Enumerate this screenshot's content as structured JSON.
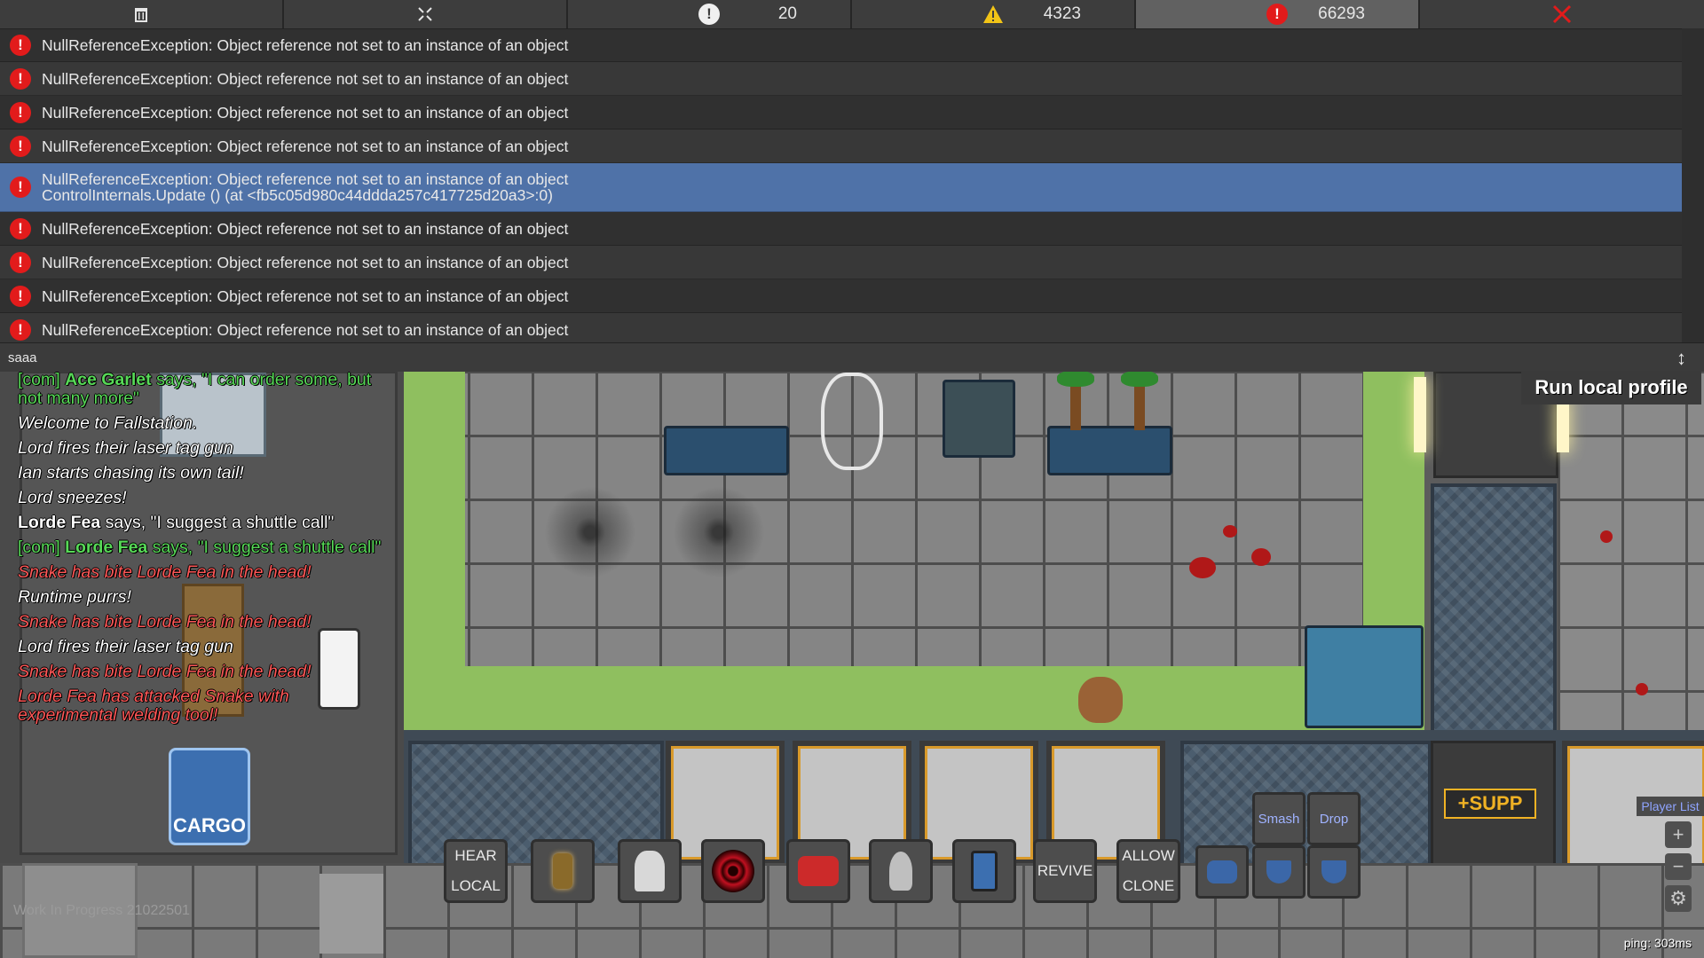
{
  "console": {
    "toolbar": {
      "clear_icon": "trash-icon",
      "collapse_icon": "collapse-arrows-icon",
      "log_icon": "info-icon",
      "log_count": "20",
      "warning_icon": "warning-icon",
      "warning_count": "4323",
      "error_icon": "error-icon",
      "error_count": "66293",
      "close_icon": "close-icon"
    },
    "entries": [
      {
        "text": "NullReferenceException: Object reference not set to an instance of an object",
        "detail": ""
      },
      {
        "text": "NullReferenceException: Object reference not set to an instance of an object",
        "detail": ""
      },
      {
        "text": "NullReferenceException: Object reference not set to an instance of an object",
        "detail": ""
      },
      {
        "text": "NullReferenceException: Object reference not set to an instance of an object",
        "detail": ""
      },
      {
        "text": "NullReferenceException: Object reference not set to an instance of an object",
        "detail": "ControlInternals.Update () (at <fb5c05d980c44ddda257c417725d20a3>:0)"
      },
      {
        "text": "NullReferenceException: Object reference not set to an instance of an object",
        "detail": ""
      },
      {
        "text": "NullReferenceException: Object reference not set to an instance of an object",
        "detail": ""
      },
      {
        "text": "NullReferenceException: Object reference not set to an instance of an object",
        "detail": ""
      },
      {
        "text": "NullReferenceException: Object reference not set to an instance of an object",
        "detail": ""
      }
    ],
    "input_value": "saaa"
  },
  "run_profile_label": "Run local profile",
  "chat": [
    {
      "type": "com",
      "prefix": "[com] ",
      "speaker": "Ace Garlet",
      "text": " says, \"I can order some, but not many more\""
    },
    {
      "type": "white",
      "prefix": "",
      "speaker": "",
      "text": "Welcome to Fallstation."
    },
    {
      "type": "white",
      "prefix": "",
      "speaker": "",
      "text": "Lord fires their laser tag gun"
    },
    {
      "type": "white",
      "prefix": "",
      "speaker": "",
      "text": "Ian starts chasing its own tail!"
    },
    {
      "type": "white",
      "prefix": "",
      "speaker": "",
      "text": "Lord sneezes!"
    },
    {
      "type": "say",
      "prefix": "",
      "speaker": "Lorde Fea",
      "text": " says, \"I suggest a shuttle call\""
    },
    {
      "type": "com",
      "prefix": "[com] ",
      "speaker": "Lorde Fea",
      "text": " says, \"I suggest a shuttle call\""
    },
    {
      "type": "atk",
      "prefix": "",
      "speaker": "",
      "text": "Snake has bite Lorde Fea in the head!"
    },
    {
      "type": "white",
      "prefix": "",
      "speaker": "",
      "text": "Runtime purrs!"
    },
    {
      "type": "atk",
      "prefix": "",
      "speaker": "",
      "text": "Snake has bite Lorde Fea in the head!"
    },
    {
      "type": "white",
      "prefix": "",
      "speaker": "",
      "text": "Lord fires their laser tag gun"
    },
    {
      "type": "atk",
      "prefix": "",
      "speaker": "",
      "text": "Snake has bite Lorde Fea in the head!"
    },
    {
      "type": "atk",
      "prefix": "",
      "speaker": "",
      "text": "Lorde Fea has attacked Snake with experimental welding tool!"
    }
  ],
  "hotbar": {
    "hear_local_top": "HEAR",
    "hear_local_bottom": "LOCAL",
    "revive": "REVIVE",
    "allow_clone_top": "ALLOW",
    "allow_clone_bottom": "CLONE",
    "smash": "Smash",
    "drop": "Drop"
  },
  "signs": {
    "cargo": "CARGO",
    "supply": "+SUPP"
  },
  "player_list": "Player List",
  "version": "Work In Progress 21022501",
  "ping": "ping: 303ms",
  "colors": {
    "error": "#e21b1b",
    "selected_row": "#4f72a8",
    "com_chat": "#57d957",
    "attack_chat": "#ff5757"
  }
}
